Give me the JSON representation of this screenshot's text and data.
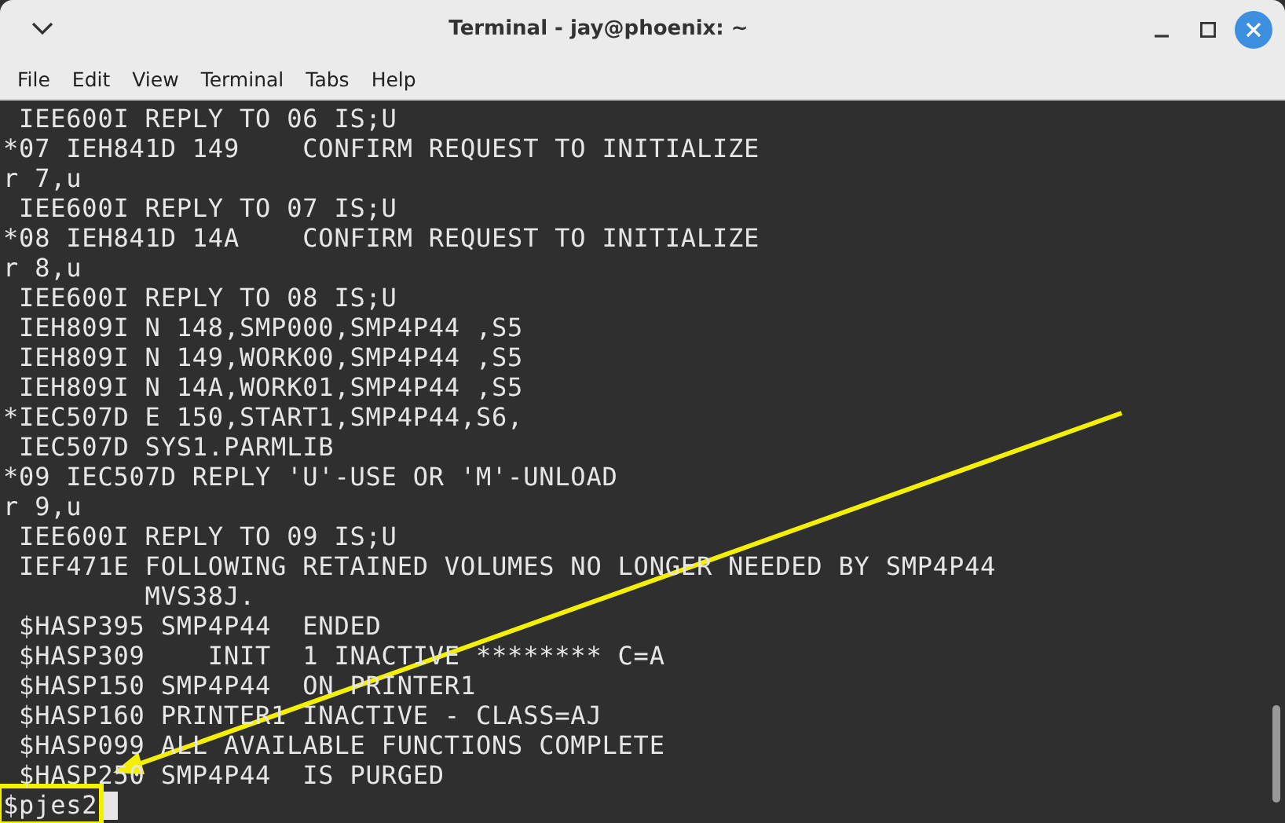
{
  "window": {
    "title": "Terminal - jay@phoenix: ~"
  },
  "menu": [
    "File",
    "Edit",
    "View",
    "Terminal",
    "Tabs",
    "Help"
  ],
  "terminal": {
    "lines": [
      " IEE600I REPLY TO 06 IS;U",
      "*07 IEH841D 149    CONFIRM REQUEST TO INITIALIZE",
      "r 7,u",
      " IEE600I REPLY TO 07 IS;U",
      "*08 IEH841D 14A    CONFIRM REQUEST TO INITIALIZE",
      "r 8,u",
      " IEE600I REPLY TO 08 IS;U",
      " IEH809I N 148,SMP000,SMP4P44 ,S5",
      " IEH809I N 149,WORK00,SMP4P44 ,S5",
      " IEH809I N 14A,WORK01,SMP4P44 ,S5",
      "*IEC507D E 150,START1,SMP4P44,S6,",
      " IEC507D SYS1.PARMLIB",
      "*09 IEC507D REPLY 'U'-USE OR 'M'-UNLOAD",
      "r 9,u",
      " IEE600I REPLY TO 09 IS;U",
      " IEF471E FOLLOWING RETAINED VOLUMES NO LONGER NEEDED BY SMP4P44",
      "         MVS38J.",
      " $HASP395 SMP4P44  ENDED",
      " $HASP309    INIT  1 INACTIVE ******** C=A",
      " $HASP150 SMP4P44  ON PRINTER1",
      " $HASP160 PRINTER1 INACTIVE - CLASS=AJ",
      " $HASP099 ALL AVAILABLE FUNCTIONS COMPLETE",
      " $HASP250 SMP4P44  IS PURGED"
    ],
    "prompt": "$pjes2"
  }
}
